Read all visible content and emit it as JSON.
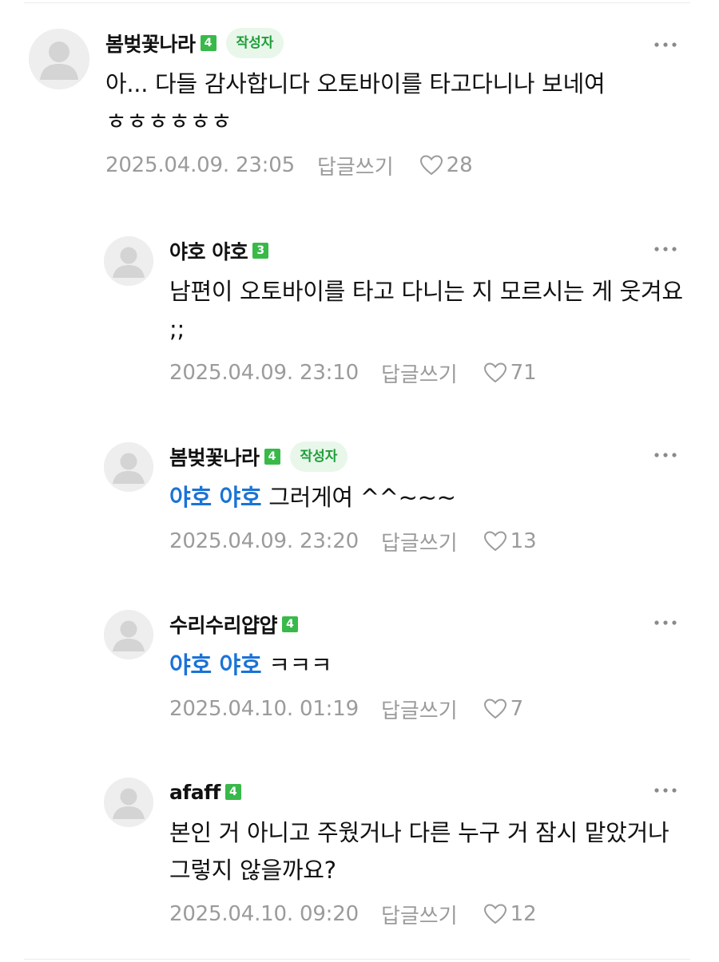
{
  "author_badge": "작성자",
  "reply_label": "답글쓰기",
  "colors": {
    "accent_green": "#39b94a",
    "mention_blue": "#1a73d6",
    "meta_gray": "#9b9b9b"
  },
  "comments": [
    {
      "nickname": "봄벚꽃나라",
      "level": "4",
      "is_author": true,
      "mention": "",
      "text": "아... 다들 감사합니다 오토바이를 타고다니나 보네여 ㅎㅎㅎㅎㅎㅎ",
      "date": "2025.04.09. 23:05",
      "likes": "28"
    },
    {
      "nickname": "야호 야호",
      "level": "3",
      "is_author": false,
      "mention": "",
      "text": "남편이 오토바이를 타고 다니는 지 모르시는 게 웃겨요 ;;",
      "date": "2025.04.09. 23:10",
      "likes": "71"
    },
    {
      "nickname": "봄벚꽃나라",
      "level": "4",
      "is_author": true,
      "mention": "야호 야호",
      "text": "그러게여 ^^~~~",
      "date": "2025.04.09. 23:20",
      "likes": "13"
    },
    {
      "nickname": "수리수리얍얍",
      "level": "4",
      "is_author": false,
      "mention": "야호 야호",
      "text": "ㅋㅋㅋ",
      "date": "2025.04.10. 01:19",
      "likes": "7"
    },
    {
      "nickname": "afaff",
      "level": "4",
      "is_author": false,
      "mention": "",
      "text": "본인 거 아니고 주웠거나 다른 누구 거 잠시 맡았거나 그렇지 않을까요?",
      "date": "2025.04.10. 09:20",
      "likes": "12"
    }
  ]
}
